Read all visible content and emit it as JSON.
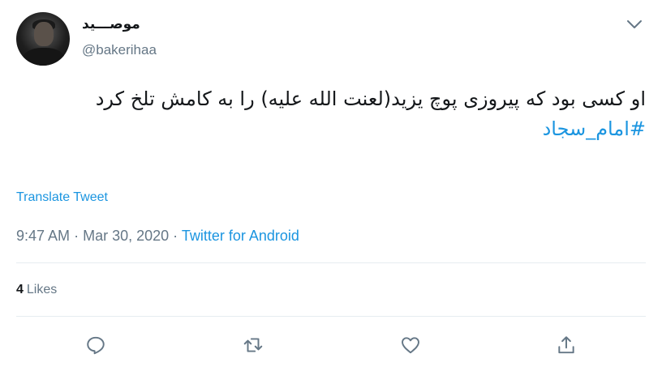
{
  "user": {
    "display_name": "موصـــيد",
    "handle": "@bakerihaa"
  },
  "tweet": {
    "text": "او کسی بود که پیروزی پوچ یزید(لعنت الله علیه) را به کامش تلخ کرد",
    "hashtag": "#امام_سجاد",
    "translate_label": "Translate Tweet",
    "time": "9:47 AM",
    "separator": "·",
    "date": "Mar 30, 2020",
    "source": "Twitter for Android"
  },
  "stats": {
    "likes_count": "4",
    "likes_label": "Likes"
  },
  "icons": {
    "menu": "chevron-down-icon",
    "reply": "reply-icon",
    "retweet": "retweet-icon",
    "like": "heart-icon",
    "share": "share-icon"
  },
  "colors": {
    "text": "#14171a",
    "secondary": "#657786",
    "link": "#1b95e0",
    "divider": "#e6ecf0"
  }
}
